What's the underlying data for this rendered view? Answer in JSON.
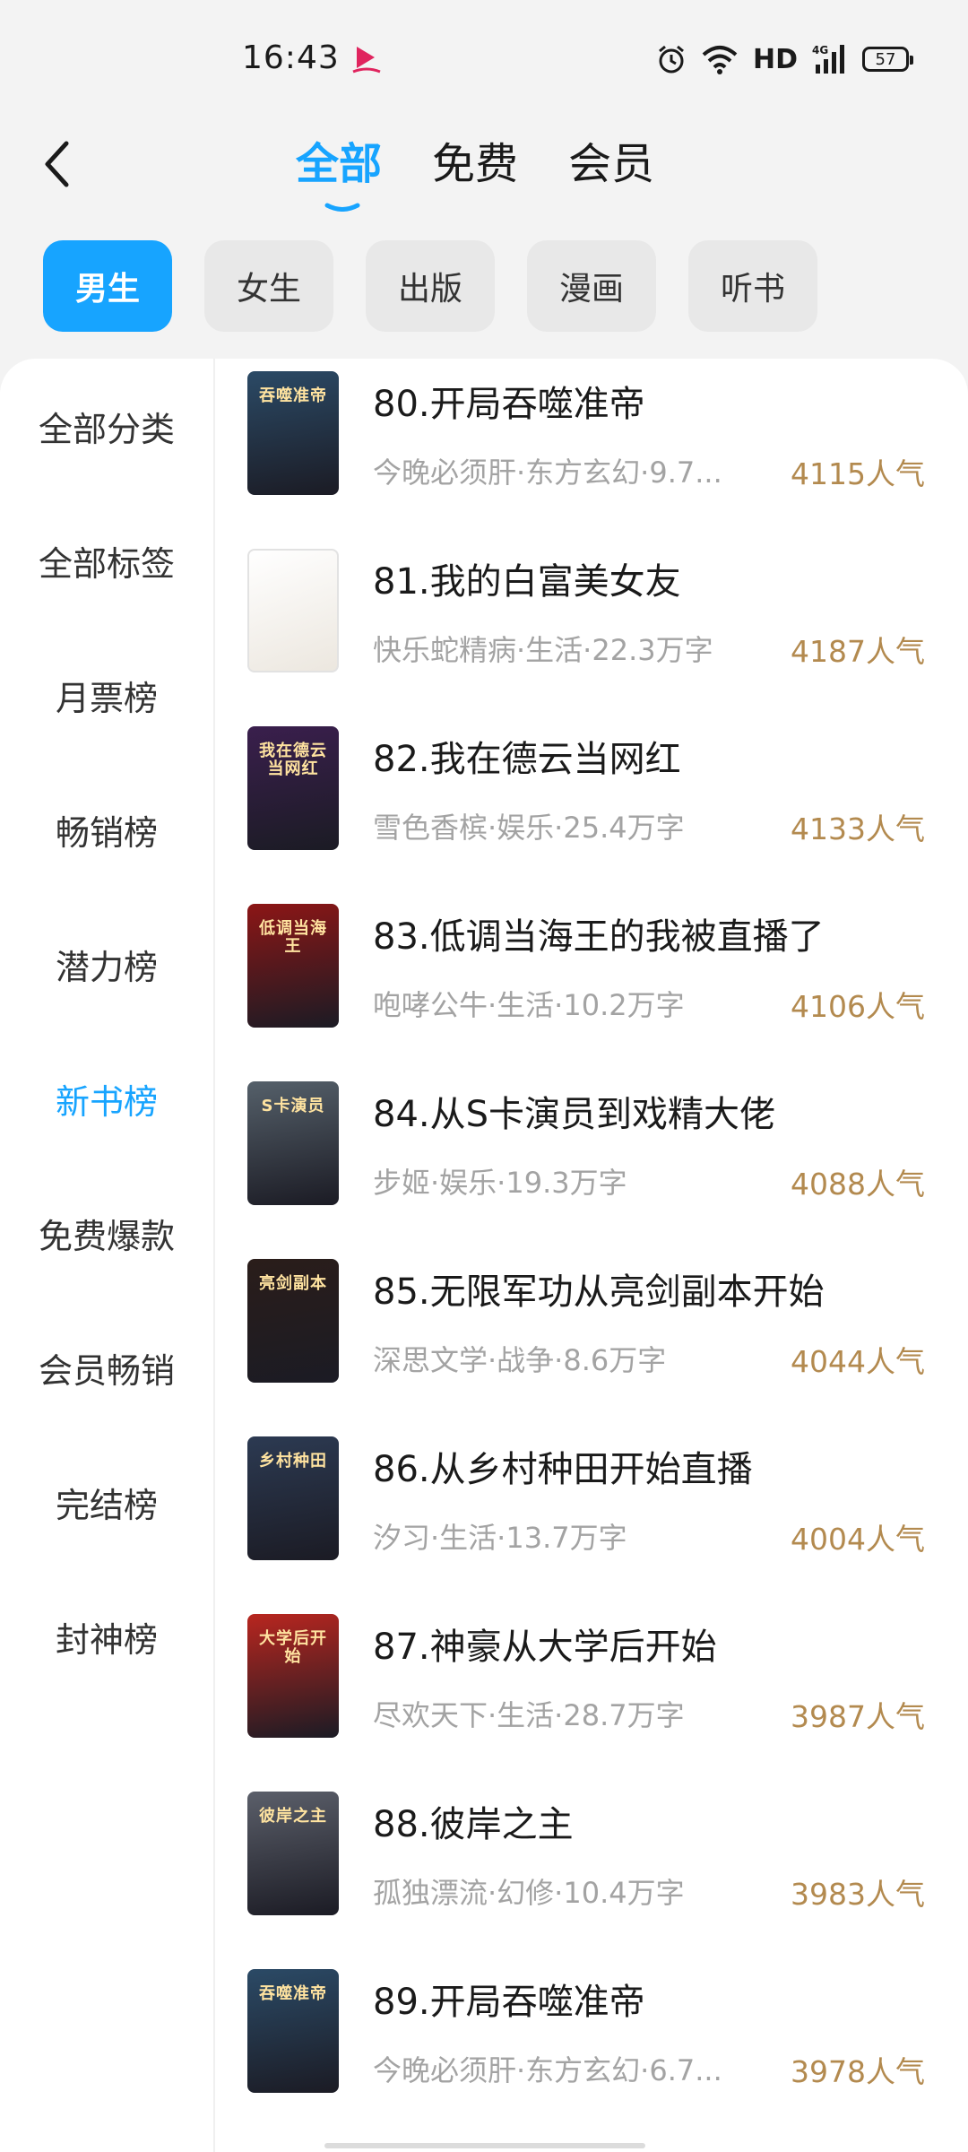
{
  "status": {
    "time": "16:43",
    "network": "HD",
    "signal_label": "4G",
    "battery": "57"
  },
  "header": {
    "tabs": [
      {
        "label": "全部",
        "active": true
      },
      {
        "label": "免费",
        "active": false
      },
      {
        "label": "会员",
        "active": false
      }
    ]
  },
  "chips": [
    {
      "label": "男生",
      "active": true
    },
    {
      "label": "女生",
      "active": false
    },
    {
      "label": "出版",
      "active": false
    },
    {
      "label": "漫画",
      "active": false
    },
    {
      "label": "听书",
      "active": false
    }
  ],
  "sidebar": {
    "items": [
      {
        "label": "全部分类",
        "active": false
      },
      {
        "label": "全部标签",
        "active": false
      },
      {
        "label": "月票榜",
        "active": false
      },
      {
        "label": "畅销榜",
        "active": false
      },
      {
        "label": "潜力榜",
        "active": false
      },
      {
        "label": "新书榜",
        "active": true
      },
      {
        "label": "免费爆款",
        "active": false
      },
      {
        "label": "会员畅销",
        "active": false
      },
      {
        "label": "完结榜",
        "active": false
      },
      {
        "label": "封神榜",
        "active": false
      }
    ]
  },
  "books": [
    {
      "title": "80.开局吞噬准帝",
      "meta": "今晚必须肝·东方玄幻·9.7...",
      "popularity": "4115人气",
      "cover_text": "吞噬准帝",
      "cover_color": "#2b4a66"
    },
    {
      "title": "81.我的白富美女友",
      "meta": "快乐蛇精病·生活·22.3万字",
      "popularity": "4187人气",
      "cover_text": "",
      "cover_color": "#f4f1ec"
    },
    {
      "title": "82.我在德云当网红",
      "meta": "雪色香槟·娱乐·25.4万字",
      "popularity": "4133人气",
      "cover_text": "我在德云当网红",
      "cover_color": "#3a1f4d"
    },
    {
      "title": "83.低调当海王的我被直播了",
      "meta": "咆哮公牛·生活·10.2万字",
      "popularity": "4106人气",
      "cover_text": "低调当海王",
      "cover_color": "#8c1616"
    },
    {
      "title": "84.从S卡演员到戏精大佬",
      "meta": "步姬·娱乐·19.3万字",
      "popularity": "4088人气",
      "cover_text": "S卡演员",
      "cover_color": "#55606a"
    },
    {
      "title": "85.无限军功从亮剑副本开始",
      "meta": "深思文学·战争·8.6万字",
      "popularity": "4044人气",
      "cover_text": "亮剑副本",
      "cover_color": "#2a1d1a"
    },
    {
      "title": "86.从乡村种田开始直播",
      "meta": "汐习·生活·13.7万字",
      "popularity": "4004人气",
      "cover_text": "乡村种田",
      "cover_color": "#2c3a52"
    },
    {
      "title": "87.神豪从大学后开始",
      "meta": "尽欢天下·生活·28.7万字",
      "popularity": "3987人气",
      "cover_text": "大学后开始",
      "cover_color": "#b8261f"
    },
    {
      "title": "88.彼岸之主",
      "meta": "孤独漂流·幻修·10.4万字",
      "popularity": "3983人气",
      "cover_text": "彼岸之主",
      "cover_color": "#5b5f6a"
    },
    {
      "title": "89.开局吞噬准帝",
      "meta": "今晚必须肝·东方玄幻·6.7...",
      "popularity": "3978人气",
      "cover_text": "吞噬准帝",
      "cover_color": "#2b4a66"
    }
  ],
  "colors": {
    "accent": "#17a4ff",
    "popularity": "#b38a4f",
    "meta": "#a3a3a3"
  }
}
